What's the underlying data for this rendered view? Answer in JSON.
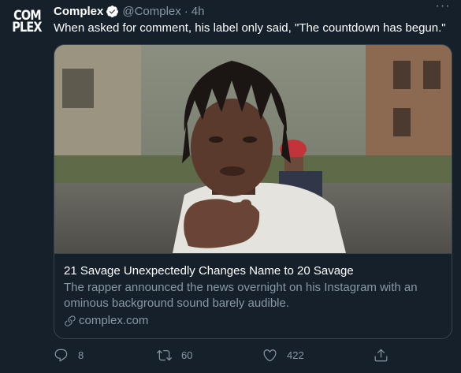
{
  "account": {
    "avatar_line1": "COM",
    "avatar_line2": "PLEX",
    "name": "Complex",
    "handle": "@Complex",
    "separator": "·",
    "time": "4h",
    "verified": true
  },
  "menu_glyph": "···",
  "tweet": {
    "text": "When asked for comment, his label only said, \"The countdown has begun.\""
  },
  "card": {
    "title": "21 Savage Unexpectedly Changes Name to 20 Savage",
    "description": "The rapper announced the news overnight on his Instagram with an ominous background sound barely audible.",
    "domain": "complex.com"
  },
  "actions": {
    "reply_count": "8",
    "retweet_count": "60",
    "like_count": "422"
  },
  "colors": {
    "background": "#15202b",
    "border": "#38444d",
    "secondary_text": "#8899a6",
    "verified": "#ffffff"
  },
  "icons": [
    "verified-badge-icon",
    "more-icon",
    "link-icon",
    "reply-icon",
    "retweet-icon",
    "like-icon",
    "share-icon"
  ]
}
